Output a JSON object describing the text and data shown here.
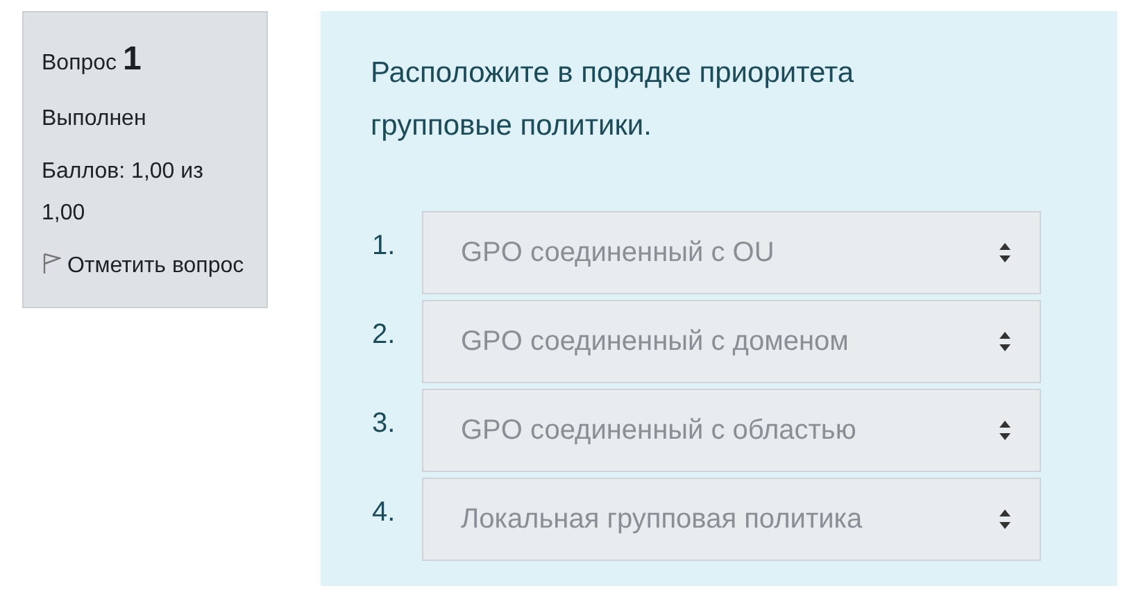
{
  "info": {
    "label": "Вопрос",
    "number": "1",
    "state": "Выполнен",
    "grade": "Баллов: 1,00 из 1,00",
    "flag": "Отметить вопрос"
  },
  "question": {
    "text": "Расположите в порядке приоритета групповые политики.",
    "answers": [
      {
        "number": "1.",
        "value": "GPO соединенный с OU",
        "disabled": true
      },
      {
        "number": "2.",
        "value": "GPO соединенный с доменом",
        "disabled": true
      },
      {
        "number": "3.",
        "value": "GPO соединенный с областью",
        "disabled": true
      },
      {
        "number": "4.",
        "value": "Локальная групповая политика",
        "disabled": true
      }
    ]
  }
}
